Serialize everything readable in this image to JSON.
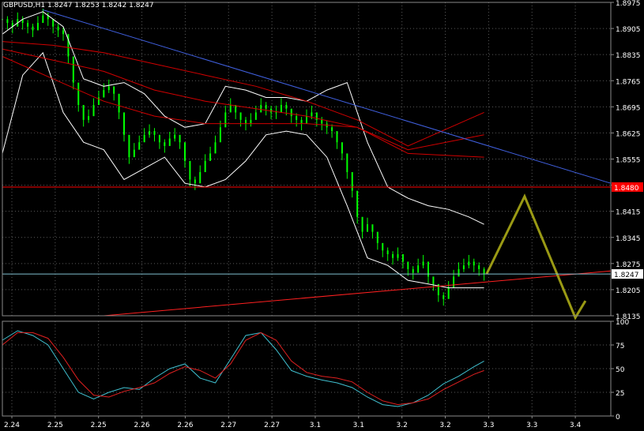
{
  "window": {
    "symbol_label": "GBPUSD,H1",
    "ohlc_label": "1.8247 1.8253 1.8242 1.8247"
  },
  "colors": {
    "background": "#000000",
    "grid": "#5a5a5a",
    "frame": "#8a8a8a",
    "candle": "#00ff00",
    "bands": "#ffffff",
    "ma": "#d00000",
    "trend_down": "#4060e0",
    "trend_up": "#ff2020",
    "resistance": "#ff0000",
    "bid": "#80c0d0",
    "projection": "#9a9a14",
    "stoch_main": "#40c0d0",
    "stoch_signal": "#e02020",
    "text": "#ffffff"
  },
  "chart_data": [
    {
      "type": "line",
      "panel": "price",
      "ylim": [
        1.8135,
        1.8975
      ],
      "y_ticks": [
        "1.8975",
        "1.8905",
        "1.8835",
        "1.8765",
        "1.8695",
        "1.8625",
        "1.8555",
        "1.8485",
        "1.8415",
        "1.8345",
        "1.8275",
        "1.8205",
        "1.8135"
      ],
      "x_ticks": [
        "2.24",
        "2.25",
        "2.25",
        "2.26",
        "2.26",
        "2.27",
        "2.27",
        "3.1",
        "3.1",
        "3.2",
        "3.2",
        "3.3",
        "3.3",
        "3.4"
      ],
      "last_price_label": "1.8247",
      "last_price": 1.8247,
      "resistance_label": "1.8480",
      "resistance": 1.848,
      "series": [
        {
          "kind": "price",
          "x": [
            0,
            2,
            4,
            6,
            8,
            10,
            12,
            14,
            16,
            18,
            20,
            22,
            24,
            26,
            28,
            30,
            32,
            34,
            36,
            38,
            40,
            42,
            44,
            46,
            48,
            50,
            52,
            54,
            56,
            58,
            60,
            62,
            64,
            66,
            68,
            70,
            72,
            74,
            76,
            78,
            80,
            82,
            84,
            86,
            88,
            90,
            92,
            94,
            96,
            98,
            100,
            102,
            104,
            106,
            108,
            110,
            112,
            114,
            116,
            118,
            120,
            122,
            124,
            126,
            128,
            130,
            132,
            134,
            136,
            138,
            140,
            142,
            144,
            146,
            148,
            150,
            152,
            154,
            156,
            158,
            160,
            162,
            164,
            166,
            168,
            170,
            172,
            174,
            176,
            178,
            180,
            182,
            184,
            186,
            188,
            190
          ],
          "values": [
            1.893,
            1.892,
            1.891,
            1.893,
            1.892,
            1.891,
            1.89,
            1.892,
            1.894,
            1.893,
            1.891,
            1.89,
            1.889,
            1.883,
            1.876,
            1.87,
            1.866,
            1.867,
            1.87,
            1.872,
            1.874,
            1.875,
            1.873,
            1.868,
            1.862,
            1.856,
            1.858,
            1.86,
            1.862,
            1.863,
            1.862,
            1.86,
            1.859,
            1.861,
            1.862,
            1.86,
            1.855,
            1.85,
            1.849,
            1.852,
            1.855,
            1.857,
            1.86,
            1.864,
            1.868,
            1.87,
            1.868,
            1.866,
            1.865,
            1.866,
            1.868,
            1.87,
            1.869,
            1.868,
            1.868,
            1.87,
            1.869,
            1.867,
            1.866,
            1.865,
            1.867,
            1.868,
            1.866,
            1.865,
            1.864,
            1.863,
            1.86,
            1.857,
            1.852,
            1.847,
            1.84,
            1.836,
            1.838,
            1.836,
            1.833,
            1.831,
            1.83,
            1.829,
            1.83,
            1.828,
            1.826,
            1.825,
            1.827,
            1.828,
            1.824,
            1.822,
            1.819,
            1.818,
            1.821,
            1.824,
            1.826,
            1.827,
            1.828,
            1.827,
            1.826,
            1.8247
          ]
        },
        {
          "kind": "band_upper",
          "x": [
            0,
            8,
            16,
            24,
            32,
            40,
            48,
            56,
            64,
            72,
            80,
            88,
            96,
            104,
            112,
            120,
            128,
            136,
            144,
            152,
            160,
            168,
            176,
            184,
            190
          ],
          "values": [
            1.889,
            1.893,
            1.895,
            1.891,
            1.877,
            1.875,
            1.876,
            1.873,
            1.867,
            1.864,
            1.865,
            1.875,
            1.874,
            1.872,
            1.872,
            1.871,
            1.874,
            1.876,
            1.86,
            1.848,
            1.845,
            1.843,
            1.842,
            1.84,
            1.838
          ]
        },
        {
          "kind": "band_lower",
          "x": [
            0,
            8,
            16,
            24,
            32,
            40,
            48,
            56,
            64,
            72,
            80,
            88,
            96,
            104,
            112,
            120,
            128,
            136,
            144,
            152,
            160,
            168,
            176,
            184,
            190
          ],
          "values": [
            1.857,
            1.878,
            1.884,
            1.868,
            1.86,
            1.858,
            1.85,
            1.853,
            1.856,
            1.849,
            1.848,
            1.85,
            1.855,
            1.862,
            1.863,
            1.862,
            1.856,
            1.843,
            1.829,
            1.827,
            1.823,
            1.822,
            1.821,
            1.821,
            1.821
          ]
        },
        {
          "kind": "ma",
          "x": [
            0,
            20,
            40,
            60,
            80,
            100,
            120,
            140,
            160,
            190
          ],
          "values": [
            1.887,
            1.886,
            1.884,
            1.881,
            1.878,
            1.875,
            1.871,
            1.866,
            1.859,
            1.868
          ]
        },
        {
          "kind": "ma",
          "x": [
            0,
            20,
            40,
            60,
            80,
            100,
            120,
            140,
            160,
            190
          ],
          "values": [
            1.885,
            1.882,
            1.879,
            1.874,
            1.871,
            1.869,
            1.867,
            1.864,
            1.858,
            1.862
          ]
        },
        {
          "kind": "ma",
          "x": [
            0,
            20,
            40,
            60,
            80,
            100,
            120,
            140,
            160,
            190
          ],
          "values": [
            1.883,
            1.877,
            1.871,
            1.867,
            1.865,
            1.865,
            1.865,
            1.864,
            1.857,
            1.856
          ]
        },
        {
          "kind": "trend_down",
          "x": [
            16,
            240
          ],
          "values": [
            1.8955,
            1.849
          ]
        },
        {
          "kind": "trend_up",
          "x": [
            40,
            240
          ],
          "values": [
            1.8135,
            1.8255
          ]
        },
        {
          "kind": "projection",
          "x": [
            191,
            206,
            226,
            230
          ],
          "values": [
            1.8247,
            1.8455,
            1.813,
            1.8175
          ]
        }
      ]
    },
    {
      "type": "line",
      "panel": "stochastic",
      "ylim": [
        0,
        100
      ],
      "y_ticks": [
        "100",
        "75",
        "50",
        "25",
        "0"
      ],
      "series": [
        {
          "kind": "stoch_main",
          "x": [
            0,
            6,
            12,
            18,
            24,
            30,
            36,
            42,
            48,
            54,
            60,
            66,
            72,
            78,
            84,
            90,
            96,
            102,
            108,
            114,
            120,
            126,
            132,
            138,
            144,
            150,
            156,
            162,
            168,
            174,
            180,
            186,
            190
          ],
          "values": [
            80,
            90,
            85,
            75,
            50,
            25,
            18,
            25,
            30,
            28,
            40,
            50,
            55,
            40,
            35,
            60,
            85,
            88,
            70,
            48,
            42,
            38,
            35,
            30,
            20,
            12,
            10,
            14,
            22,
            34,
            42,
            52,
            58
          ]
        },
        {
          "kind": "stoch_signal",
          "x": [
            0,
            6,
            12,
            18,
            24,
            30,
            36,
            42,
            48,
            54,
            60,
            66,
            72,
            78,
            84,
            90,
            96,
            102,
            108,
            114,
            120,
            126,
            132,
            138,
            144,
            150,
            156,
            162,
            168,
            174,
            180,
            186,
            190
          ],
          "values": [
            75,
            88,
            88,
            82,
            62,
            38,
            22,
            20,
            26,
            30,
            35,
            45,
            52,
            48,
            40,
            55,
            80,
            88,
            80,
            58,
            46,
            42,
            40,
            36,
            25,
            16,
            12,
            14,
            18,
            28,
            36,
            44,
            48
          ]
        }
      ]
    }
  ]
}
